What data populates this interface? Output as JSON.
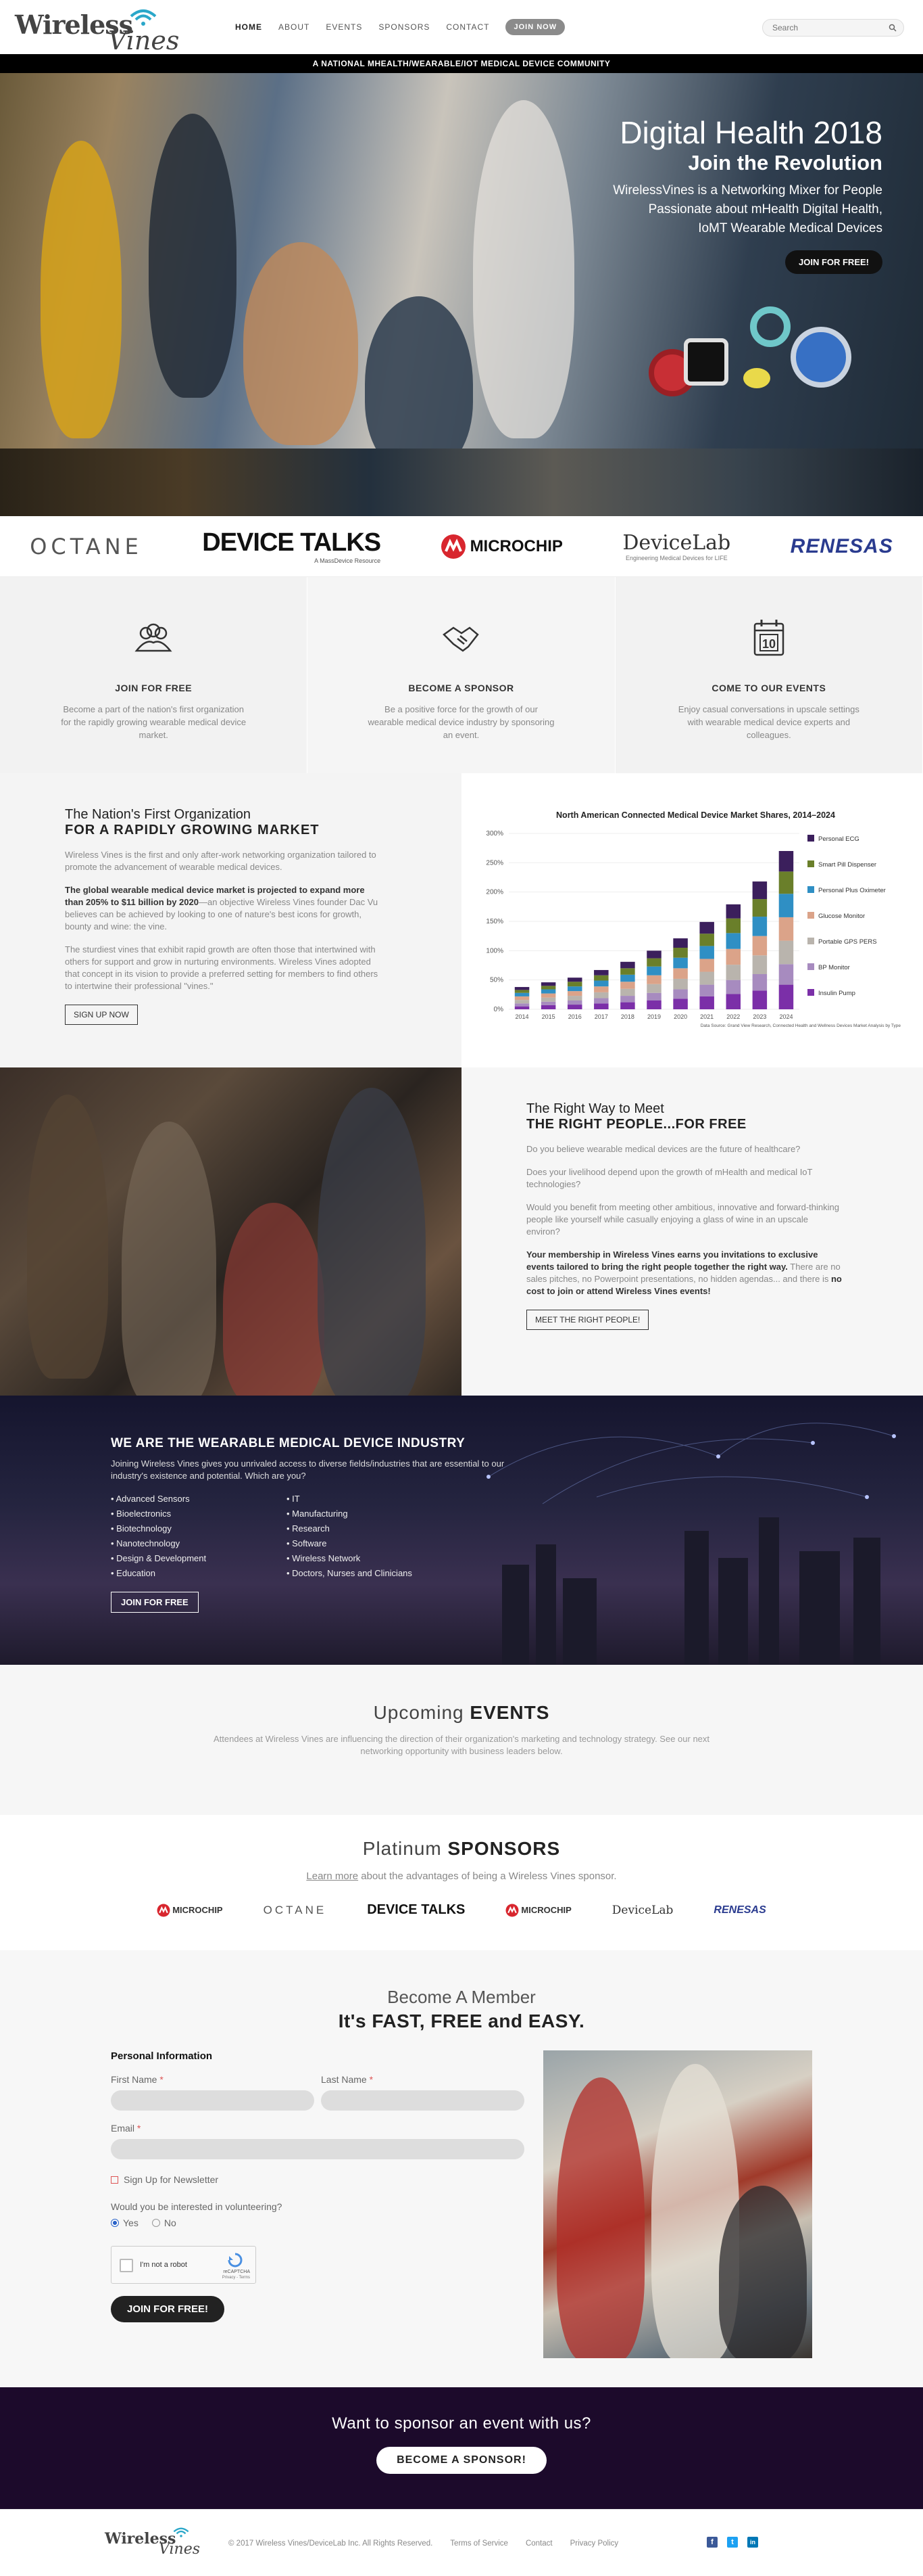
{
  "header": {
    "logo_word1": "Wireless",
    "logo_word2": "Vines",
    "nav": [
      "HOME",
      "ABOUT",
      "EVENTS",
      "SPONSORS",
      "CONTACT",
      "JOIN NOW"
    ],
    "search_placeholder": "Search"
  },
  "banner": "A NATIONAL MHEALTH/WEARABLE/IOT MEDICAL DEVICE COMMUNITY",
  "hero": {
    "title": "Digital Health 2018",
    "subtitle": "Join the Revolution",
    "lines": [
      "WirelessVines is a Networking Mixer for People",
      "Passionate about mHealth Digital Health,",
      "IoMT Wearable Medical Devices"
    ],
    "button": "JOIN FOR FREE!"
  },
  "logos": [
    "OCTANE",
    "DEVICE TALKS",
    "MICROCHIP",
    "DeviceLab",
    "RENESAS"
  ],
  "logo_subs": {
    "devicetalks": "A MassDevice Resource",
    "devicelab": "Engineering Medical Devices for LIFE"
  },
  "features": [
    {
      "icon": "people-icon",
      "title": "JOIN FOR FREE",
      "text": "Become a part of the nation's first organization for the rapidly growing wearable medical device market."
    },
    {
      "icon": "handshake-icon",
      "title": "BECOME A SPONSOR",
      "text": "Be a positive force for the growth of our wearable medical device industry by sponsoring an event."
    },
    {
      "icon": "calendar-icon",
      "title": "COME TO OUR EVENTS",
      "text": "Enjoy casual conversations in upscale settings with wearable medical device experts and colleagues."
    }
  ],
  "calendar_day": "10",
  "nation": {
    "title": "The Nation's First Organization",
    "title_bold": "FOR A RAPIDLY GROWING MARKET",
    "p1": "Wireless Vines is the first and only after-work networking organization tailored to promote the advancement of wearable medical devices.",
    "p2_bold": "The global wearable medical device market is projected to expand more than 205% to $11 billion by 2020",
    "p2_rest": "—an objective Wireless Vines founder Dac Vu believes can be achieved by looking to one of nature's best icons for growth, bounty and wine: the vine.",
    "p3": "The sturdiest vines that exhibit rapid growth are often those that intertwined with others for support and grow in nurturing environments. Wireless Vines adopted that concept in its vision to provide a preferred setting for members to find others to intertwine their professional \"vines.\"",
    "button": "SIGN UP NOW"
  },
  "chart_data": {
    "type": "bar",
    "title": "North American Connected Medical Device Market Shares, 2014–2024",
    "categories": [
      "2014",
      "2015",
      "2016",
      "2017",
      "2018",
      "2019",
      "2020",
      "2021",
      "2022",
      "2023",
      "2024"
    ],
    "ylim": [
      0,
      300
    ],
    "yticks": [
      "0%",
      "50%",
      "100%",
      "150%",
      "200%",
      "250%",
      "300%"
    ],
    "series": [
      {
        "name": "Insulin Pump",
        "color": "#7b2fa8",
        "values": [
          5,
          7,
          8,
          10,
          12,
          15,
          18,
          22,
          26,
          32,
          42
        ]
      },
      {
        "name": "BP Monitor",
        "color": "#a78bbf",
        "values": [
          5,
          6,
          7,
          9,
          11,
          13,
          16,
          20,
          24,
          28,
          35
        ]
      },
      {
        "name": "Portable GPS PERS",
        "color": "#b9b4ad",
        "values": [
          6,
          7,
          8,
          10,
          12,
          15,
          18,
          22,
          26,
          32,
          40
        ]
      },
      {
        "name": "Glucose Monitor",
        "color": "#dba389",
        "values": [
          6,
          7,
          8,
          10,
          12,
          15,
          18,
          22,
          27,
          33,
          40
        ]
      },
      {
        "name": "Personal Plus Oximeter",
        "color": "#2f8fc4",
        "values": [
          6,
          7,
          8,
          10,
          12,
          15,
          18,
          22,
          27,
          33,
          40
        ]
      },
      {
        "name": "Smart Pill Dispenser",
        "color": "#6a7f2a",
        "values": [
          5,
          6,
          8,
          9,
          11,
          14,
          17,
          21,
          25,
          30,
          38
        ]
      },
      {
        "name": "Personal ECG",
        "color": "#3b1f5c",
        "values": [
          5,
          6,
          7,
          9,
          11,
          13,
          16,
          20,
          24,
          30,
          35
        ]
      }
    ],
    "note": "Data Source: Grand View Research, Connected Health and Wellness Devices Market Analysis by Type"
  },
  "rightway": {
    "title": "The Right Way to Meet",
    "title_bold": "THE RIGHT PEOPLE...FOR FREE",
    "q1": "Do you believe wearable medical devices are the future of healthcare?",
    "q2": "Does your livelihood depend upon the growth of mHealth and medical IoT technologies?",
    "q3": "Would you benefit from meeting other ambitious, innovative and forward-thinking people like yourself while casually enjoying a glass of wine in an upscale environ?",
    "p_bold": "Your membership in Wireless Vines earns you invitations to exclusive events tailored to bring the right people together the right way.",
    "p_rest": "There are no sales pitches, no Powerpoint presentations, no hidden agendas... and there is",
    "p_bold2": "no cost to join or attend Wireless Vines events!",
    "button": "MEET THE RIGHT PEOPLE!"
  },
  "industry": {
    "title": "WE ARE THE WEARABLE MEDICAL DEVICE INDUSTRY",
    "text": "Joining Wireless Vines gives you unrivaled access to diverse fields/industries that are essential to our industry's existence and potential. Which are you?",
    "items": [
      "Advanced Sensors",
      "IT",
      "Bioelectronics",
      "Manufacturing",
      "Biotechnology",
      "Research",
      "Nanotechnology",
      "Software",
      "Design & Development",
      "Wireless Network",
      "Education",
      "Doctors, Nurses and Clinicians"
    ],
    "button": "JOIN FOR FREE"
  },
  "events": {
    "title_light": "Upcoming",
    "title_bold": "EVENTS",
    "text": "Attendees at Wireless Vines are influencing the direction of their organization's marketing and technology strategy. See our next networking opportunity with business leaders below."
  },
  "sponsors": {
    "title_light": "Platinum",
    "title_bold": "SPONSORS",
    "link": "Learn more",
    "text": "about the advantages of being a Wireless Vines sponsor.",
    "logos": [
      "MICROCHIP",
      "OCTANE",
      "DEVICE TALKS",
      "MICROCHIP",
      "DeviceLab",
      "RENESAS"
    ]
  },
  "member": {
    "title": "Become A Member",
    "subtitle": "It's FAST, FREE and EASY.",
    "section": "Personal Information",
    "first": "First Name",
    "last": "Last Name",
    "email": "Email",
    "required": "*",
    "newsletter": "Sign Up for Newsletter",
    "volunteer": "Would you be interested in volunteering?",
    "yes": "Yes",
    "no": "No",
    "captcha": "I'm not a robot",
    "captcha_brand": "reCAPTCHA",
    "captcha_terms": "Privacy - Terms",
    "button": "JOIN FOR FREE!"
  },
  "cta": {
    "title": "Want to sponsor an event with us?",
    "button": "BECOME A SPONSOR!"
  },
  "footer": {
    "copyright": "© 2017 Wireless Vines/DeviceLab Inc. All Rights Reserved.",
    "links": [
      "Terms of Service",
      "Contact",
      "Privacy Policy"
    ],
    "social": [
      "f",
      "t",
      "in"
    ]
  }
}
